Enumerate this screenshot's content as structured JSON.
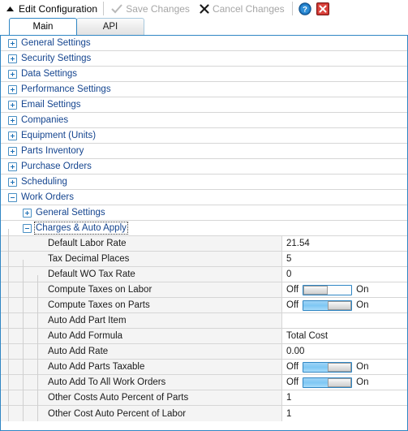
{
  "window": {
    "title": "Edit Configuration",
    "caret_icon": "caret-up-icon"
  },
  "toolbar": {
    "save_label": "Save Changes",
    "save_icon": "checkmark-icon",
    "save_enabled": false,
    "cancel_label": "Cancel Changes",
    "cancel_icon": "x-icon",
    "cancel_enabled": false,
    "help_icon": "help-circle-icon",
    "close_icon": "close-window-icon",
    "accent_color": "#2f86c4",
    "disabled_text_color": "#a6a6a6"
  },
  "tabs": [
    {
      "label": "Main",
      "active": true
    },
    {
      "label": "API",
      "active": false
    }
  ],
  "tree": {
    "groups": [
      {
        "label": "General Settings",
        "expanded": false,
        "level": 0
      },
      {
        "label": "Security Settings",
        "expanded": false,
        "level": 0
      },
      {
        "label": "Data Settings",
        "expanded": false,
        "level": 0
      },
      {
        "label": "Performance Settings",
        "expanded": false,
        "level": 0
      },
      {
        "label": "Email Settings",
        "expanded": false,
        "level": 0
      },
      {
        "label": "Companies",
        "expanded": false,
        "level": 0
      },
      {
        "label": "Equipment (Units)",
        "expanded": false,
        "level": 0
      },
      {
        "label": "Parts Inventory",
        "expanded": false,
        "level": 0
      },
      {
        "label": "Purchase Orders",
        "expanded": false,
        "level": 0
      },
      {
        "label": "Scheduling",
        "expanded": false,
        "level": 0
      },
      {
        "label": "Work Orders",
        "expanded": true,
        "level": 0
      },
      {
        "label": "General Settings",
        "expanded": false,
        "level": 1
      },
      {
        "label": "Charges & Auto Apply",
        "expanded": true,
        "level": 1,
        "focused": true
      }
    ],
    "properties": [
      {
        "label": "Default Labor Rate",
        "value": "21.54",
        "type": "text"
      },
      {
        "label": "Tax Decimal Places",
        "value": "5",
        "type": "text"
      },
      {
        "label": "Default WO Tax Rate",
        "value": "0",
        "type": "text"
      },
      {
        "label": "Compute Taxes on Labor",
        "value": "",
        "type": "toggle",
        "state": "off",
        "off_label": "Off",
        "on_label": "On"
      },
      {
        "label": "Compute Taxes on Parts",
        "value": "",
        "type": "toggle",
        "state": "on",
        "off_label": "Off",
        "on_label": "On"
      },
      {
        "label": "Auto Add Part Item",
        "value": "",
        "type": "text"
      },
      {
        "label": "Auto Add Formula",
        "value": "Total Cost",
        "type": "text"
      },
      {
        "label": "Auto Add Rate",
        "value": "0.00",
        "type": "text"
      },
      {
        "label": "Auto Add Parts Taxable",
        "value": "",
        "type": "toggle",
        "state": "on",
        "off_label": "Off",
        "on_label": "On"
      },
      {
        "label": "Auto Add To All Work Orders",
        "value": "",
        "type": "toggle",
        "state": "on",
        "off_label": "Off",
        "on_label": "On"
      },
      {
        "label": "Other Costs Auto Percent of Parts",
        "value": "1",
        "type": "text"
      },
      {
        "label": "Other Cost Auto Percent of Labor",
        "value": "1",
        "type": "text"
      }
    ]
  },
  "colors": {
    "group_text": "#15458f",
    "border": "#2f86c4",
    "row_line": "#d6d6d6",
    "label_bg": "#f4f4f4",
    "toggle_fill": "#7ec7f4"
  }
}
